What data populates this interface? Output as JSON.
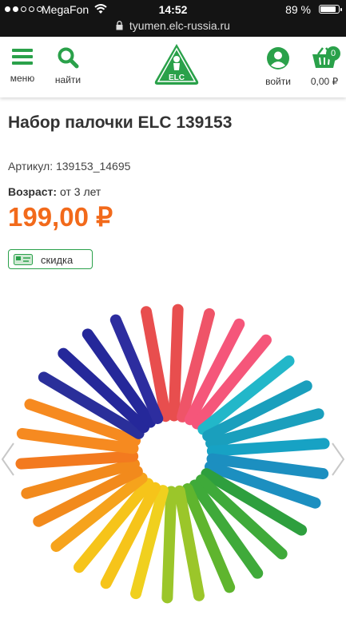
{
  "status": {
    "carrier": "MegaFon",
    "time": "14:52",
    "battery": "89 %",
    "signal_bars": 2
  },
  "browser": {
    "url": "tyumen.elc-russia.ru"
  },
  "header": {
    "menu_label": "меню",
    "search_label": "найти",
    "login_label": "войти",
    "cart_count": "0",
    "cart_total": "0,00 ₽",
    "logo_text": "ELC"
  },
  "product": {
    "title": "Набор палочки ELC 139153",
    "article": "Артикул: 139153_14695",
    "age_label": "Возраст:",
    "age_value": " от 3 лет",
    "price": "199,00 ₽",
    "discount_label": "скидка"
  },
  "colors": {
    "brand_green": "#2aa14a",
    "price_orange": "#f26a1b",
    "stick_colors": [
      "#e84e4e",
      "#ef5468",
      "#f5567a",
      "#22b7c9",
      "#1a9fbd",
      "#17a2c4",
      "#1c8fc0",
      "#2e9f3e",
      "#3faa3a",
      "#5fb52e",
      "#9bc62a",
      "#f0d01e",
      "#f6c41a",
      "#f6a31c",
      "#f28a1c",
      "#f37a1f",
      "#f68a20",
      "#2a2f9a",
      "#25289a",
      "#2d2d9f"
    ]
  }
}
